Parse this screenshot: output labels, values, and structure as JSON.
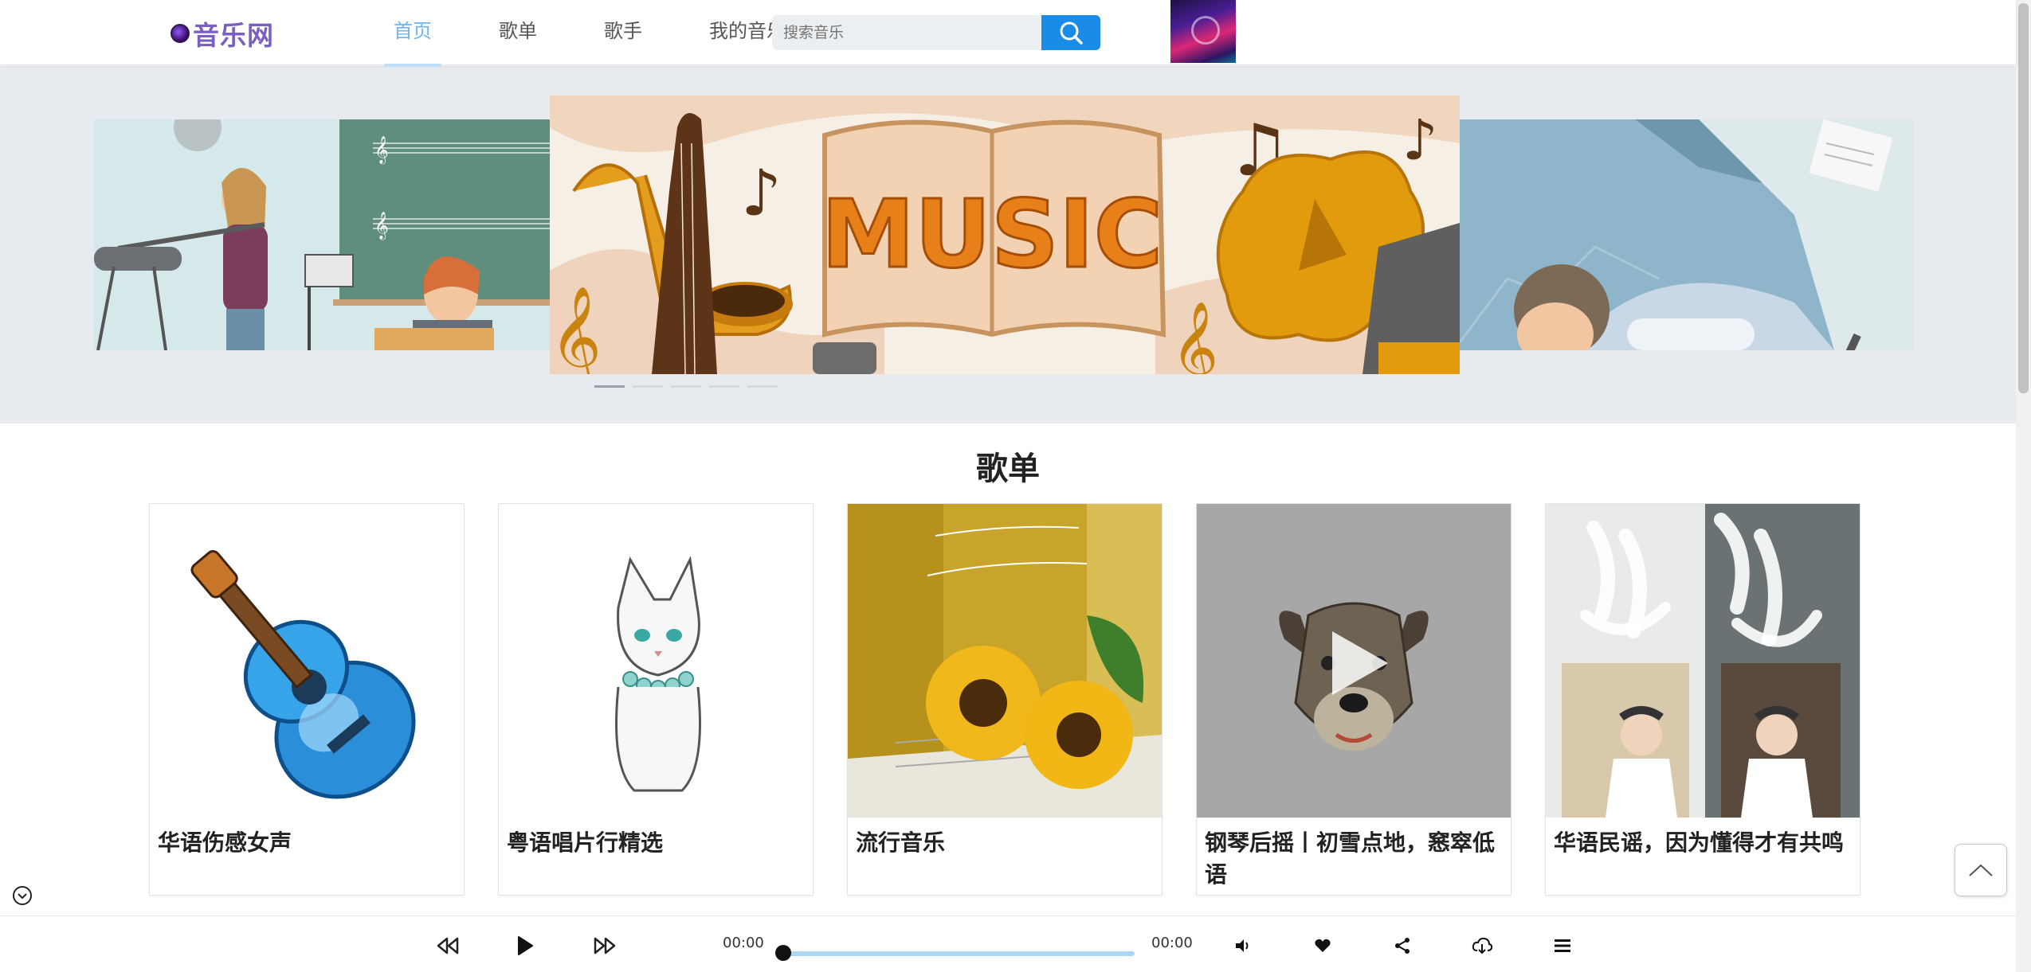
{
  "header": {
    "logo_text": "音乐网",
    "nav": [
      {
        "label": "首页",
        "active": true
      },
      {
        "label": "歌单",
        "active": false
      },
      {
        "label": "歌手",
        "active": false
      },
      {
        "label": "我的音乐",
        "active": false
      }
    ],
    "search": {
      "placeholder": "搜索音乐",
      "value": ""
    }
  },
  "banner": {
    "main_text": "MUSIC",
    "indicator_count": 5,
    "active_indicator": 0
  },
  "section": {
    "title": "歌单",
    "cards": [
      {
        "title": "华语伤感女声",
        "image": "guitar"
      },
      {
        "title": "粤语唱片行精选",
        "image": "cat"
      },
      {
        "title": "流行音乐",
        "image": "sunflowers"
      },
      {
        "title": "钢琴后摇丨初雪点地，窸窣低语",
        "image": "dog"
      },
      {
        "title": "华语民谣，因为懂得才有共鸣",
        "image": "album-poster"
      }
    ]
  },
  "player": {
    "current_time": "00:00",
    "total_time": "00:00",
    "progress": 0
  },
  "colors": {
    "accent": "#6cb6ec",
    "search_button": "#1a8be6",
    "logo": "#7a5fc0",
    "progress": "#a9d6f5"
  }
}
